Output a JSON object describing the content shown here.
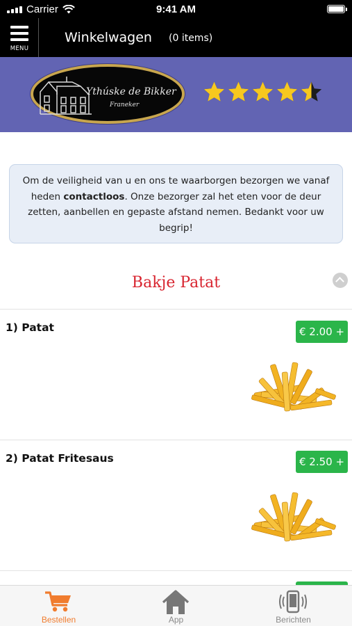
{
  "status_bar": {
    "carrier": "Carrier",
    "time": "9:41 AM"
  },
  "nav": {
    "menu_label": "MENU",
    "title": "Winkelwagen",
    "item_count": "(0 items)"
  },
  "restaurant": {
    "logo_name": "Ythúske de Bikker",
    "logo_town": "Franeker",
    "rating": 4.5,
    "rating_max": 5
  },
  "notice": {
    "before": "Om de veiligheid van u en ons te waarborgen bezorgen we vanaf heden ",
    "bold": "contactloos",
    "after": ". Onze bezorger zal het eten voor de deur zetten, aanbellen en gepaste afstand nemen. Bedankt voor uw begrip!"
  },
  "category": {
    "title": "Bakje Patat"
  },
  "products": [
    {
      "name": "1)  Patat",
      "price": "€ 2.00 +"
    },
    {
      "name": "2)  Patat Fritesaus",
      "price": "€ 2.50 +"
    }
  ],
  "tabs": [
    {
      "label": "Bestellen",
      "icon": "cart-icon",
      "active": true
    },
    {
      "label": "App",
      "icon": "home-icon",
      "active": false
    },
    {
      "label": "Berichten",
      "icon": "phone-vibrate-icon",
      "active": false
    }
  ],
  "colors": {
    "banner": "#6264b3",
    "accent_red": "#d8242f",
    "price_green": "#2bb54a",
    "tab_active": "#f07c2e",
    "star_gold": "#f7c81f",
    "notice_bg": "#e8eef7"
  }
}
